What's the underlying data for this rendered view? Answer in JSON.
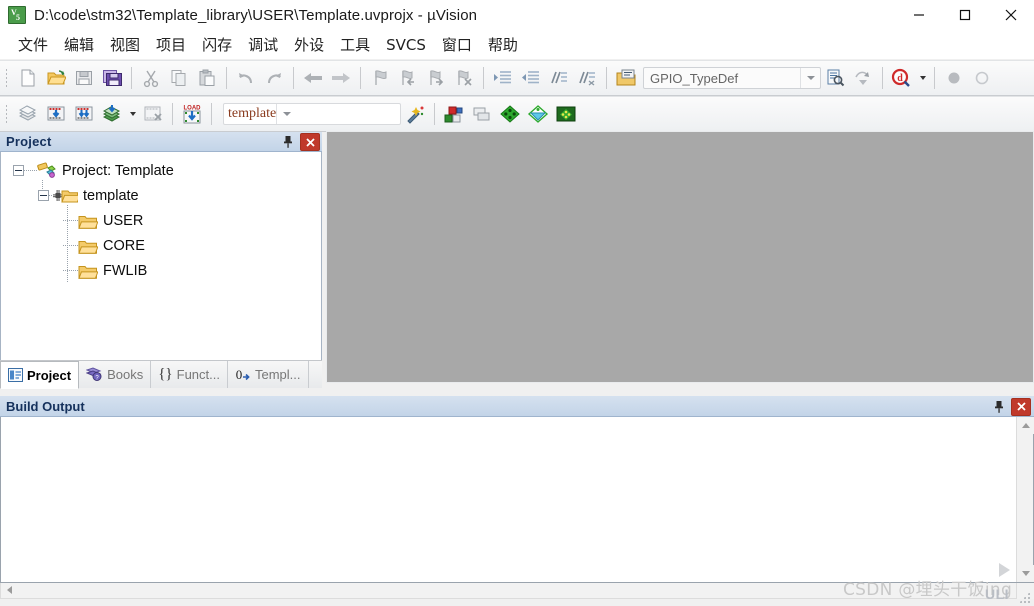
{
  "window": {
    "title": "D:\\code\\stm32\\Template_library\\USER\\Template.uvprojx - µVision",
    "app_icon": "keil-uvision-icon",
    "controls": {
      "minimize": "minimize-icon",
      "maximize": "maximize-icon",
      "close": "close-icon"
    }
  },
  "menubar": {
    "items": [
      {
        "label": "文件",
        "mnemonic": "文"
      },
      {
        "label": "编辑",
        "mnemonic": "编"
      },
      {
        "label": "视图",
        "mnemonic": "视"
      },
      {
        "label": "项目",
        "mnemonic": "项"
      },
      {
        "label": "闪存",
        "mnemonic": "闪"
      },
      {
        "label": "调试",
        "mnemonic": "调"
      },
      {
        "label": "外设",
        "mnemonic": "外"
      },
      {
        "label": "工具",
        "mnemonic": "工"
      },
      {
        "label": "SVCS",
        "mnemonic": "S"
      },
      {
        "label": "窗口",
        "mnemonic": "窗"
      },
      {
        "label": "帮助",
        "mnemonic": "帮"
      }
    ]
  },
  "toolbar_file": {
    "buttons": [
      {
        "name": "new-file-icon",
        "title": "New"
      },
      {
        "name": "open-file-icon",
        "title": "Open"
      },
      {
        "name": "save-icon",
        "title": "Save"
      },
      {
        "name": "save-all-icon",
        "title": "Save All"
      },
      {
        "name": "cut-icon",
        "title": "Cut"
      },
      {
        "name": "copy-icon",
        "title": "Copy"
      },
      {
        "name": "paste-icon",
        "title": "Paste"
      },
      {
        "name": "undo-icon",
        "title": "Undo"
      },
      {
        "name": "redo-icon",
        "title": "Redo"
      },
      {
        "name": "navigate-back-icon",
        "title": "Back"
      },
      {
        "name": "navigate-forward-icon",
        "title": "Forward"
      },
      {
        "name": "bookmark-toggle-icon",
        "title": "Insert/Remove Bookmark"
      },
      {
        "name": "bookmark-prev-icon",
        "title": "Previous Bookmark"
      },
      {
        "name": "bookmark-next-icon",
        "title": "Next Bookmark"
      },
      {
        "name": "bookmark-clear-icon",
        "title": "Clear All Bookmarks"
      },
      {
        "name": "indent-icon",
        "title": "Indent"
      },
      {
        "name": "outdent-icon",
        "title": "Outdent"
      },
      {
        "name": "comment-icon",
        "title": "Comment"
      },
      {
        "name": "uncomment-icon",
        "title": "Uncomment"
      },
      {
        "name": "configuration-wizard-icon",
        "title": "Configuration Wizard"
      }
    ],
    "find_combo": {
      "value": "GPIO_TypeDef",
      "name": "find-combo"
    },
    "after_combo": [
      {
        "name": "find-in-files-icon",
        "title": "Find in Files"
      },
      {
        "name": "incremental-find-icon",
        "title": "Incremental Find"
      },
      {
        "name": "debug-start-icon",
        "title": "Start/Stop Debug Session"
      }
    ]
  },
  "toolbar_build": {
    "buttons": [
      {
        "name": "translate-icon",
        "title": "Translate"
      },
      {
        "name": "build-icon",
        "title": "Build"
      },
      {
        "name": "rebuild-icon",
        "title": "Rebuild"
      },
      {
        "name": "batch-build-icon",
        "title": "Batch Build"
      },
      {
        "name": "stop-build-icon",
        "title": "Stop Build"
      },
      {
        "name": "load-icon",
        "title": "Download / LOAD"
      }
    ],
    "target_combo": {
      "value": "template",
      "name": "select-target-combo"
    },
    "right_buttons": [
      {
        "name": "target-options-wizard-icon",
        "title": "Target Options Wizard"
      },
      {
        "name": "manage-project-items-icon",
        "title": "Manage Project Items"
      },
      {
        "name": "manage-multi-project-icon",
        "title": "Multi-Project Workspace"
      },
      {
        "name": "pack-installer-green-icon",
        "title": "Pack Installer"
      },
      {
        "name": "manage-run-time-env-icon",
        "title": "Manage Run-Time Environment"
      },
      {
        "name": "pack-installer-icon",
        "title": "Pack Installer"
      }
    ]
  },
  "project_panel": {
    "title": "Project",
    "pin_icon": "pin-icon",
    "close_icon": "close-icon",
    "tree": [
      {
        "label": "Project: Template",
        "icon": "project-icon",
        "level": 0,
        "expanded": true
      },
      {
        "label": "template",
        "icon": "target-icon",
        "level": 1,
        "expanded": true
      },
      {
        "label": "USER",
        "icon": "folder-icon",
        "level": 2,
        "expanded": null
      },
      {
        "label": "CORE",
        "icon": "folder-icon",
        "level": 2,
        "expanded": null
      },
      {
        "label": "FWLIB",
        "icon": "folder-icon",
        "level": 2,
        "expanded": null
      }
    ],
    "tabs": [
      {
        "label": "Project",
        "icon": "project-tab-icon",
        "active": true
      },
      {
        "label": "Books",
        "icon": "books-tab-icon",
        "active": false
      },
      {
        "label": "Funct...",
        "icon": "functions-tab-icon",
        "active": false
      },
      {
        "label": "Templ...",
        "icon": "templates-tab-icon",
        "active": false
      }
    ]
  },
  "build_output": {
    "title": "Build Output",
    "pin_icon": "pin-icon",
    "close_icon": "close-icon",
    "content": "",
    "scroll": {
      "up_icon": "scroll-up-icon",
      "down_icon": "scroll-down-icon",
      "left_icon": "scroll-left-icon",
      "right_icon": "scroll-right-icon"
    }
  },
  "watermark": {
    "text": "CSDN @埋头干饭ing",
    "ulink_label": "ULI"
  },
  "colors": {
    "panel_title_start": "#d5e1ef",
    "panel_title_end": "#c3d4e8",
    "panel_title_text": "#15315c",
    "editor_background": "#a8a8a8",
    "close_button": "#c0392b",
    "target_text": "#8a3b1e",
    "toolbar_start": "#fbfbfb",
    "toolbar_end": "#eef0f2"
  }
}
